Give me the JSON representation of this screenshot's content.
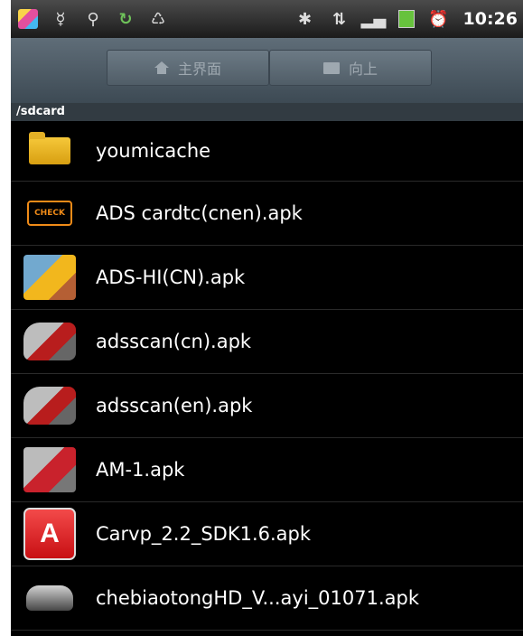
{
  "status_bar": {
    "left_icons": [
      "app-icon",
      "usb-debug-icon",
      "usb-icon",
      "sync-icon",
      "recycle-icon"
    ],
    "right_icons": [
      "bluetooth-icon",
      "network-type-icon",
      "signal-icon",
      "battery-icon",
      "alarm-icon"
    ],
    "time": "10:26"
  },
  "toolbar": {
    "home_label": "主界面",
    "up_label": "向上"
  },
  "path": "/sdcard",
  "files": [
    {
      "name": "youmicache",
      "icon": "folder-icon"
    },
    {
      "name": "ADS cardtc(cnen).apk",
      "icon": "check-engine-icon"
    },
    {
      "name": "ADS-HI(CN).apk",
      "icon": "truck-mechanic-icon"
    },
    {
      "name": "adsscan(cn).apk",
      "icon": "car-scan-icon"
    },
    {
      "name": "adsscan(en).apk",
      "icon": "car-scan-icon"
    },
    {
      "name": "AM-1.apk",
      "icon": "motorcycle-icon"
    },
    {
      "name": "Carvp_2.2_SDK1.6.apk",
      "icon": "red-a-app-icon"
    },
    {
      "name": "chebiaotongHD_V...ayi_01071.apk",
      "icon": "car-icon"
    }
  ],
  "colors": {
    "background": "#000000",
    "toolbar": "#4b5964",
    "path_bar": "#323b42",
    "folder": "#e7b323",
    "red_app": "#d71d20"
  }
}
